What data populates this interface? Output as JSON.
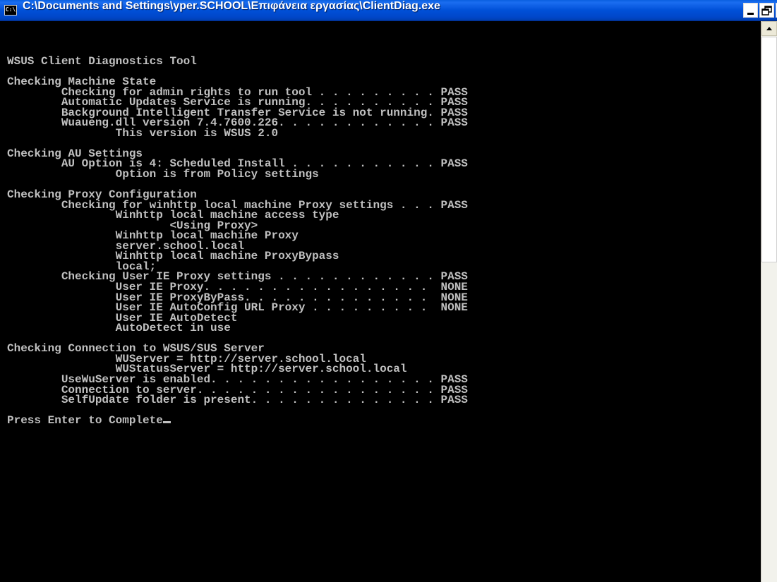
{
  "window": {
    "title": "C:\\Documents and Settings\\yper.SCHOOL\\Επιφάνεια εργασίας\\ClientDiag.exe",
    "icon_label": "C:\\",
    "controls": {
      "minimize_icon": "minimize-icon",
      "maximize_icon": "maximize-icon",
      "close_icon": "close-icon"
    }
  },
  "console": {
    "lines": [
      "WSUS Client Diagnostics Tool",
      "",
      "Checking Machine State",
      "        Checking for admin rights to run tool . . . . . . . . . PASS",
      "        Automatic Updates Service is running. . . . . . . . . . PASS",
      "        Background Intelligent Transfer Service is not running. PASS",
      "        Wuaueng.dll version 7.4.7600.226. . . . . . . . . . . . PASS",
      "                This version is WSUS 2.0",
      "",
      "Checking AU Settings",
      "        AU Option is 4: Scheduled Install . . . . . . . . . . . PASS",
      "                Option is from Policy settings",
      "",
      "Checking Proxy Configuration",
      "        Checking for winhttp local machine Proxy settings . . . PASS",
      "                Winhttp local machine access type",
      "                        <Using Proxy>",
      "                Winhttp local machine Proxy",
      "                server.school.local",
      "                Winhttp local machine ProxyBypass",
      "                local;",
      "        Checking User IE Proxy settings . . . . . . . . . . . . PASS",
      "                User IE Proxy. . . . . . . . . . . . . . . . .  NONE",
      "                User IE ProxyByPass. . . . . . . . . . . . . .  NONE",
      "                User IE AutoConfig URL Proxy . . . . . . . . .  NONE",
      "                User IE AutoDetect",
      "                AutoDetect in use",
      "",
      "Checking Connection to WSUS/SUS Server",
      "                WUServer = http://server.school.local",
      "                WUStatusServer = http://server.school.local",
      "        UseWuServer is enabled. . . . . . . . . . . . . . . . . PASS",
      "        Connection to server. . . . . . . . . . . . . . . . . . PASS",
      "        SelfUpdate folder is present. . . . . . . . . . . . . . PASS",
      "",
      "Press Enter to Complete"
    ]
  },
  "scrollbar": {
    "up_icon": "scroll-up-arrow-icon"
  }
}
